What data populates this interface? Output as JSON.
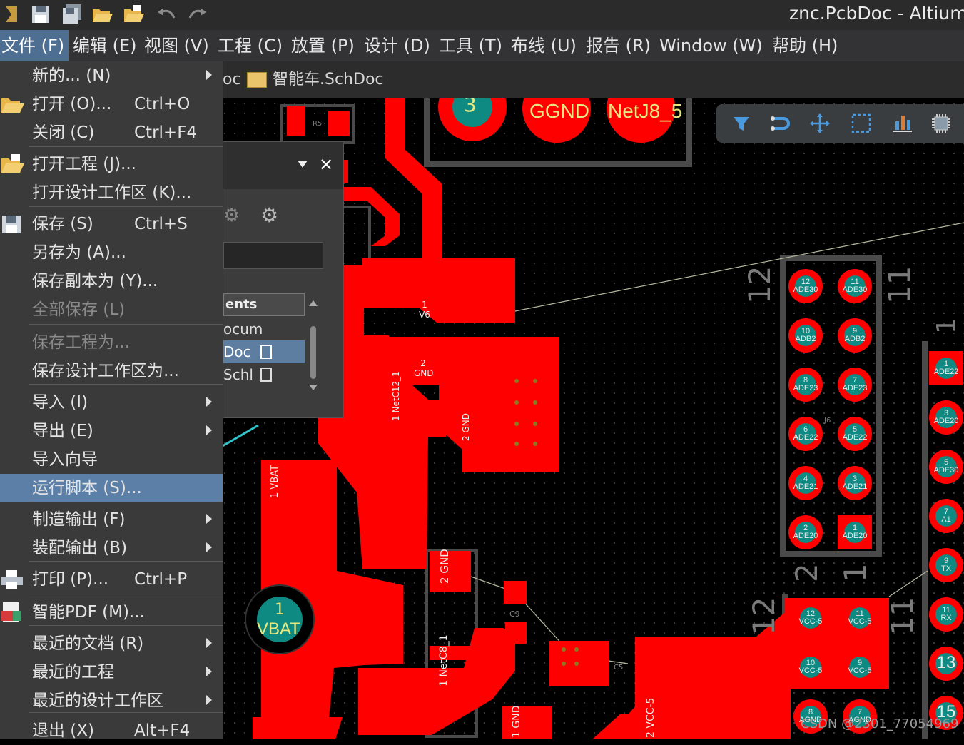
{
  "window": {
    "title": "znc.PcbDoc - Altium D"
  },
  "menubar": {
    "items": [
      "文件 (F)",
      "编辑 (E)",
      "视图 (V)",
      "工程 (C)",
      "放置 (P)",
      "设计 (D)",
      "工具 (T)",
      "布线 (U)",
      "报告 (R)",
      "Window (W)",
      "帮助 (H)"
    ]
  },
  "tabs": [
    {
      "label": "oc"
    },
    {
      "label": "智能车.SchDoc"
    }
  ],
  "filemenu": {
    "items": [
      {
        "label": "新的... (N)",
        "shortcut": "",
        "submenu": true
      },
      {
        "label": "打开 (O)...",
        "shortcut": "Ctrl+O",
        "icon": "open-folder-icon"
      },
      {
        "label": "关闭 (C)",
        "shortcut": "Ctrl+F4"
      },
      {
        "label": "打开工程 (J)...",
        "shortcut": "",
        "icon": "open-project-icon"
      },
      {
        "label": "打开设计工作区 (K)...",
        "shortcut": ""
      },
      {
        "label": "保存 (S)",
        "shortcut": "Ctrl+S",
        "icon": "save-icon"
      },
      {
        "label": "另存为 (A)...",
        "shortcut": ""
      },
      {
        "label": "保存副本为 (Y)...",
        "shortcut": ""
      },
      {
        "label": "全部保存 (L)",
        "shortcut": "",
        "disabled": true
      },
      {
        "label": "保存工程为...",
        "shortcut": "",
        "disabled": true
      },
      {
        "label": "保存设计工作区为...",
        "shortcut": ""
      },
      {
        "label": "导入 (I)",
        "shortcut": "",
        "submenu": true
      },
      {
        "label": "导出 (E)",
        "shortcut": "",
        "submenu": true
      },
      {
        "label": "导入向导",
        "shortcut": ""
      },
      {
        "label": "运行脚本 (S)...",
        "shortcut": "",
        "highlighted": true
      },
      {
        "label": "制造输出 (F)",
        "shortcut": "",
        "submenu": true
      },
      {
        "label": "装配输出 (B)",
        "shortcut": "",
        "submenu": true
      },
      {
        "label": "打印 (P)...",
        "shortcut": "Ctrl+P",
        "icon": "print-icon"
      },
      {
        "label": "智能PDF (M)...",
        "shortcut": "",
        "icon": "pdf-icon"
      },
      {
        "label": "最近的文档 (R)",
        "shortcut": "",
        "submenu": true
      },
      {
        "label": "最近的工程",
        "shortcut": "",
        "submenu": true
      },
      {
        "label": "最近的设计工作区",
        "shortcut": "",
        "submenu": true
      },
      {
        "label": "退出 (X)",
        "shortcut": "Alt+F4"
      }
    ]
  },
  "panel": {
    "column_header": "ents",
    "rows": [
      "ocum",
      "Doc",
      "Schl"
    ]
  },
  "pcb": {
    "big_pads": [
      "3",
      "GGND",
      "NetJ8_5"
    ],
    "vbat_pad": {
      "num": "1",
      "net": "VBAT"
    },
    "labels": {
      "v6": [
        "1",
        "V6"
      ],
      "gnd_a": [
        "2",
        "GND"
      ],
      "netc12": [
        "1",
        "NetC12_1"
      ],
      "gnd_b": [
        "2",
        "GND"
      ],
      "vbat": [
        "1",
        "VBAT"
      ],
      "gnd_c": [
        "2",
        "GND"
      ],
      "netc8": [
        "1",
        "NetC8_1"
      ],
      "gnd_d": [
        "1",
        "GND"
      ],
      "vcc5": [
        "2",
        "VCC-5"
      ],
      "r5": "R5",
      "c9": "C9",
      "c5": "C5",
      "j6": "J6"
    },
    "header_top": {
      "silk_left": "12",
      "silk_right": "11",
      "silk_bottom_left": "2",
      "silk_bottom_right": "1",
      "pads": [
        [
          "12",
          "ADE30"
        ],
        [
          "11",
          "ADE30"
        ],
        [
          "10",
          "ADB2"
        ],
        [
          "9",
          "ADB2"
        ],
        [
          "8",
          "ADE23"
        ],
        [
          "7",
          "ADE23"
        ],
        [
          "6",
          "ADE22"
        ],
        [
          "5",
          "ADE22"
        ],
        [
          "4",
          "ADE21"
        ],
        [
          "3",
          "ADE21"
        ],
        [
          "2",
          "ADE20"
        ],
        [
          "1",
          "ADE20"
        ]
      ]
    },
    "header_bottom": {
      "silk_left": "12",
      "silk_right": "11",
      "pads": [
        [
          "12",
          "VCC-5"
        ],
        [
          "11",
          "VCC-5"
        ],
        [
          "10",
          "VCC-5"
        ],
        [
          "9",
          "VCC-5"
        ],
        [
          "8",
          "AGND"
        ],
        [
          "7",
          "AGND"
        ]
      ]
    },
    "right_column": {
      "silk": "1",
      "pads": [
        [
          "1",
          "ADE22"
        ],
        [
          "3",
          "ADE20"
        ],
        [
          "5",
          "ADE30"
        ],
        [
          "7",
          "A1"
        ],
        [
          "9",
          "TX"
        ],
        [
          "11",
          "RX"
        ],
        [
          "13",
          ""
        ],
        [
          "15",
          ""
        ]
      ]
    }
  },
  "watermark": "CSDN @2301_77054969",
  "colors": {
    "copper": "#ff0000",
    "pad_teal": "#0f8a82",
    "menu_highlight": "#5b7fa6",
    "annotation_arrow": "#2ec4c9"
  }
}
